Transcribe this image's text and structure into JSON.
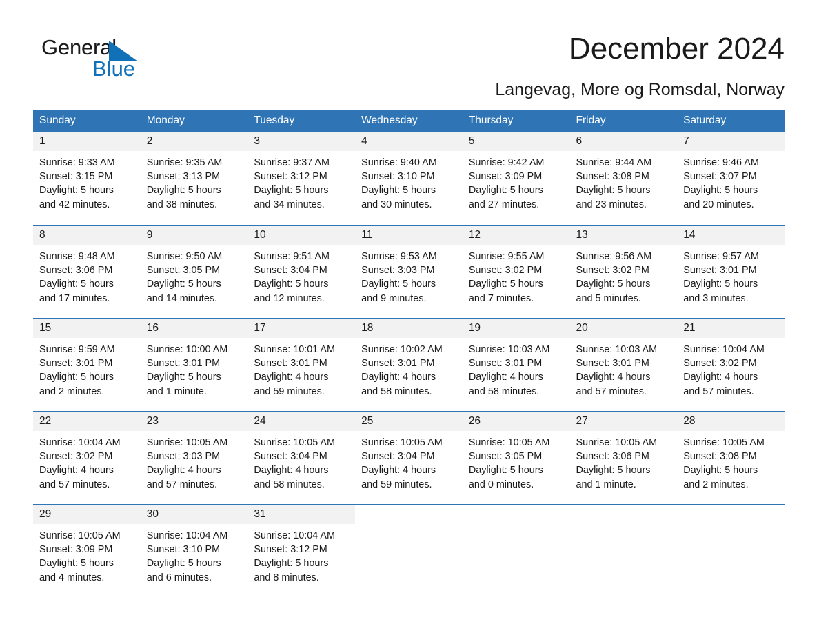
{
  "brand": {
    "name_part1": "General",
    "name_part2": "Blue",
    "triangle_color": "#1071b8",
    "blue_color": "#1071b8"
  },
  "header": {
    "title": "December 2024",
    "subtitle": "Langevag, More og Romsdal, Norway"
  },
  "colors": {
    "header_blue": "#2f75b5",
    "date_band_gray": "#f2f2f2",
    "text": "#1a1a1a"
  },
  "calendar": {
    "weekdays": [
      "Sunday",
      "Monday",
      "Tuesday",
      "Wednesday",
      "Thursday",
      "Friday",
      "Saturday"
    ],
    "weeks": [
      [
        {
          "day": "1",
          "sunrise": "Sunrise: 9:33 AM",
          "sunset": "Sunset: 3:15 PM",
          "daylight1": "Daylight: 5 hours",
          "daylight2": "and 42 minutes."
        },
        {
          "day": "2",
          "sunrise": "Sunrise: 9:35 AM",
          "sunset": "Sunset: 3:13 PM",
          "daylight1": "Daylight: 5 hours",
          "daylight2": "and 38 minutes."
        },
        {
          "day": "3",
          "sunrise": "Sunrise: 9:37 AM",
          "sunset": "Sunset: 3:12 PM",
          "daylight1": "Daylight: 5 hours",
          "daylight2": "and 34 minutes."
        },
        {
          "day": "4",
          "sunrise": "Sunrise: 9:40 AM",
          "sunset": "Sunset: 3:10 PM",
          "daylight1": "Daylight: 5 hours",
          "daylight2": "and 30 minutes."
        },
        {
          "day": "5",
          "sunrise": "Sunrise: 9:42 AM",
          "sunset": "Sunset: 3:09 PM",
          "daylight1": "Daylight: 5 hours",
          "daylight2": "and 27 minutes."
        },
        {
          "day": "6",
          "sunrise": "Sunrise: 9:44 AM",
          "sunset": "Sunset: 3:08 PM",
          "daylight1": "Daylight: 5 hours",
          "daylight2": "and 23 minutes."
        },
        {
          "day": "7",
          "sunrise": "Sunrise: 9:46 AM",
          "sunset": "Sunset: 3:07 PM",
          "daylight1": "Daylight: 5 hours",
          "daylight2": "and 20 minutes."
        }
      ],
      [
        {
          "day": "8",
          "sunrise": "Sunrise: 9:48 AM",
          "sunset": "Sunset: 3:06 PM",
          "daylight1": "Daylight: 5 hours",
          "daylight2": "and 17 minutes."
        },
        {
          "day": "9",
          "sunrise": "Sunrise: 9:50 AM",
          "sunset": "Sunset: 3:05 PM",
          "daylight1": "Daylight: 5 hours",
          "daylight2": "and 14 minutes."
        },
        {
          "day": "10",
          "sunrise": "Sunrise: 9:51 AM",
          "sunset": "Sunset: 3:04 PM",
          "daylight1": "Daylight: 5 hours",
          "daylight2": "and 12 minutes."
        },
        {
          "day": "11",
          "sunrise": "Sunrise: 9:53 AM",
          "sunset": "Sunset: 3:03 PM",
          "daylight1": "Daylight: 5 hours",
          "daylight2": "and 9 minutes."
        },
        {
          "day": "12",
          "sunrise": "Sunrise: 9:55 AM",
          "sunset": "Sunset: 3:02 PM",
          "daylight1": "Daylight: 5 hours",
          "daylight2": "and 7 minutes."
        },
        {
          "day": "13",
          "sunrise": "Sunrise: 9:56 AM",
          "sunset": "Sunset: 3:02 PM",
          "daylight1": "Daylight: 5 hours",
          "daylight2": "and 5 minutes."
        },
        {
          "day": "14",
          "sunrise": "Sunrise: 9:57 AM",
          "sunset": "Sunset: 3:01 PM",
          "daylight1": "Daylight: 5 hours",
          "daylight2": "and 3 minutes."
        }
      ],
      [
        {
          "day": "15",
          "sunrise": "Sunrise: 9:59 AM",
          "sunset": "Sunset: 3:01 PM",
          "daylight1": "Daylight: 5 hours",
          "daylight2": "and 2 minutes."
        },
        {
          "day": "16",
          "sunrise": "Sunrise: 10:00 AM",
          "sunset": "Sunset: 3:01 PM",
          "daylight1": "Daylight: 5 hours",
          "daylight2": "and 1 minute."
        },
        {
          "day": "17",
          "sunrise": "Sunrise: 10:01 AM",
          "sunset": "Sunset: 3:01 PM",
          "daylight1": "Daylight: 4 hours",
          "daylight2": "and 59 minutes."
        },
        {
          "day": "18",
          "sunrise": "Sunrise: 10:02 AM",
          "sunset": "Sunset: 3:01 PM",
          "daylight1": "Daylight: 4 hours",
          "daylight2": "and 58 minutes."
        },
        {
          "day": "19",
          "sunrise": "Sunrise: 10:03 AM",
          "sunset": "Sunset: 3:01 PM",
          "daylight1": "Daylight: 4 hours",
          "daylight2": "and 58 minutes."
        },
        {
          "day": "20",
          "sunrise": "Sunrise: 10:03 AM",
          "sunset": "Sunset: 3:01 PM",
          "daylight1": "Daylight: 4 hours",
          "daylight2": "and 57 minutes."
        },
        {
          "day": "21",
          "sunrise": "Sunrise: 10:04 AM",
          "sunset": "Sunset: 3:02 PM",
          "daylight1": "Daylight: 4 hours",
          "daylight2": "and 57 minutes."
        }
      ],
      [
        {
          "day": "22",
          "sunrise": "Sunrise: 10:04 AM",
          "sunset": "Sunset: 3:02 PM",
          "daylight1": "Daylight: 4 hours",
          "daylight2": "and 57 minutes."
        },
        {
          "day": "23",
          "sunrise": "Sunrise: 10:05 AM",
          "sunset": "Sunset: 3:03 PM",
          "daylight1": "Daylight: 4 hours",
          "daylight2": "and 57 minutes."
        },
        {
          "day": "24",
          "sunrise": "Sunrise: 10:05 AM",
          "sunset": "Sunset: 3:04 PM",
          "daylight1": "Daylight: 4 hours",
          "daylight2": "and 58 minutes."
        },
        {
          "day": "25",
          "sunrise": "Sunrise: 10:05 AM",
          "sunset": "Sunset: 3:04 PM",
          "daylight1": "Daylight: 4 hours",
          "daylight2": "and 59 minutes."
        },
        {
          "day": "26",
          "sunrise": "Sunrise: 10:05 AM",
          "sunset": "Sunset: 3:05 PM",
          "daylight1": "Daylight: 5 hours",
          "daylight2": "and 0 minutes."
        },
        {
          "day": "27",
          "sunrise": "Sunrise: 10:05 AM",
          "sunset": "Sunset: 3:06 PM",
          "daylight1": "Daylight: 5 hours",
          "daylight2": "and 1 minute."
        },
        {
          "day": "28",
          "sunrise": "Sunrise: 10:05 AM",
          "sunset": "Sunset: 3:08 PM",
          "daylight1": "Daylight: 5 hours",
          "daylight2": "and 2 minutes."
        }
      ],
      [
        {
          "day": "29",
          "sunrise": "Sunrise: 10:05 AM",
          "sunset": "Sunset: 3:09 PM",
          "daylight1": "Daylight: 5 hours",
          "daylight2": "and 4 minutes."
        },
        {
          "day": "30",
          "sunrise": "Sunrise: 10:04 AM",
          "sunset": "Sunset: 3:10 PM",
          "daylight1": "Daylight: 5 hours",
          "daylight2": "and 6 minutes."
        },
        {
          "day": "31",
          "sunrise": "Sunrise: 10:04 AM",
          "sunset": "Sunset: 3:12 PM",
          "daylight1": "Daylight: 5 hours",
          "daylight2": "and 8 minutes."
        },
        null,
        null,
        null,
        null
      ]
    ]
  }
}
